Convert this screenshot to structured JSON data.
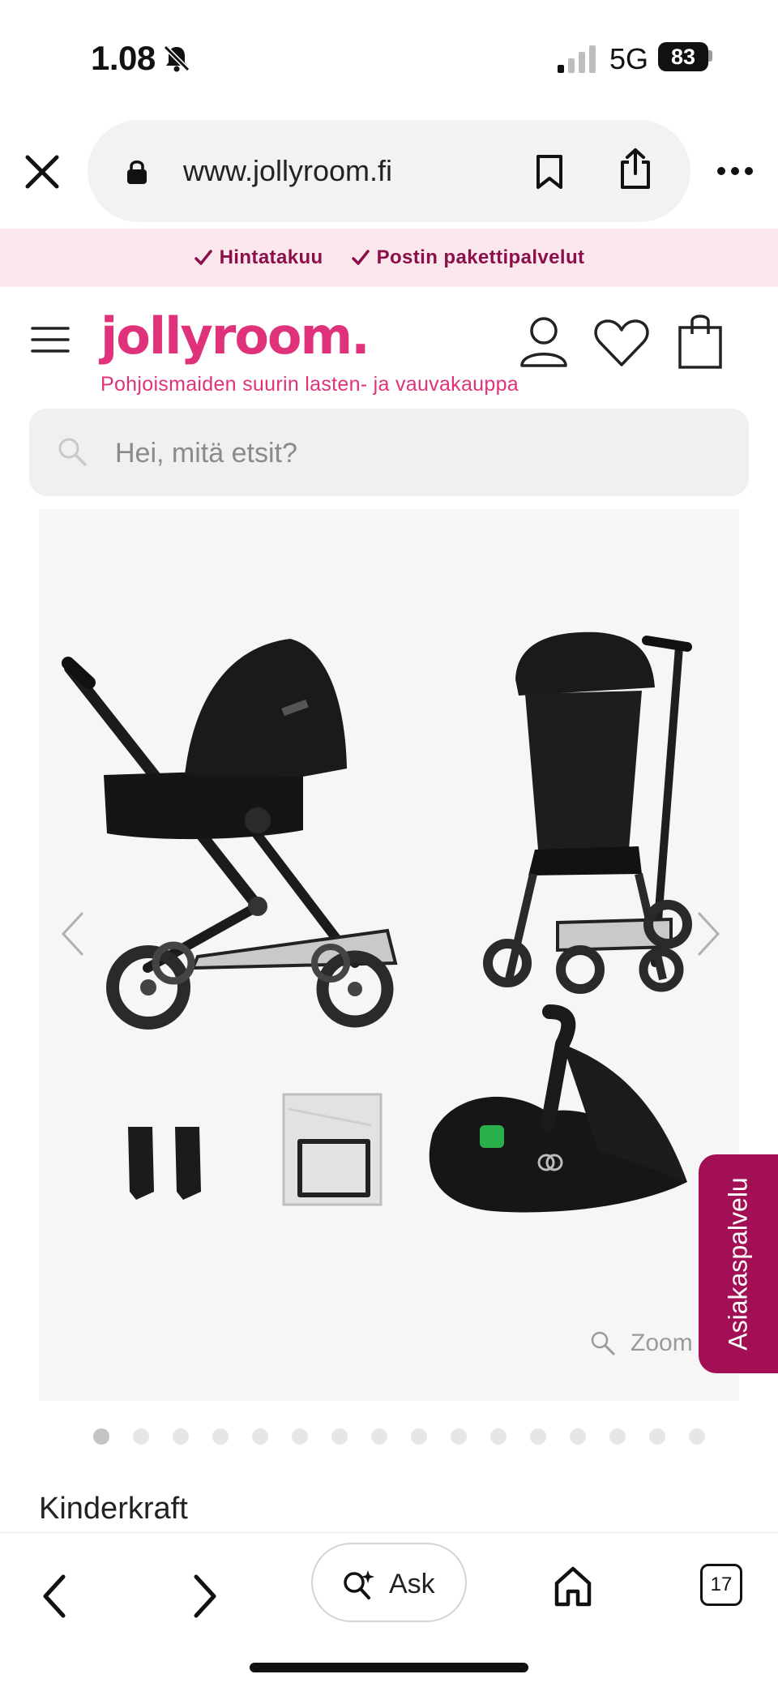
{
  "status_bar": {
    "time": "1.08",
    "network": "5G",
    "battery": "83"
  },
  "browser": {
    "url": "www.jollyroom.fi",
    "icons": [
      "close-icon",
      "lock-icon",
      "bookmark-icon",
      "share-icon",
      "more-icon"
    ]
  },
  "promo": {
    "items": [
      {
        "label": "Hintatakuu"
      },
      {
        "label": "Postin pakettipalvelut"
      }
    ],
    "accent_color": "#8a0f4a",
    "background_color": "#fce8ec"
  },
  "site_header": {
    "logo": "jollyroom.",
    "tagline": "Pohjoismaiden suurin lasten- ja vauvakauppa",
    "brand_color": "#e0327a",
    "icons": [
      "menu-icon",
      "account-icon",
      "heart-icon",
      "cart-icon"
    ]
  },
  "search": {
    "placeholder": "Hei, mitä etsit?"
  },
  "gallery": {
    "zoom_label": "Zoom",
    "dot_count": 16,
    "active_dot": 1
  },
  "customer_service": {
    "label": "Asiakaspalvelu",
    "color": "#a30f54"
  },
  "product": {
    "brand": "Kinderkraft"
  },
  "toolbar": {
    "ask_label": "Ask",
    "tab_count": "17"
  }
}
